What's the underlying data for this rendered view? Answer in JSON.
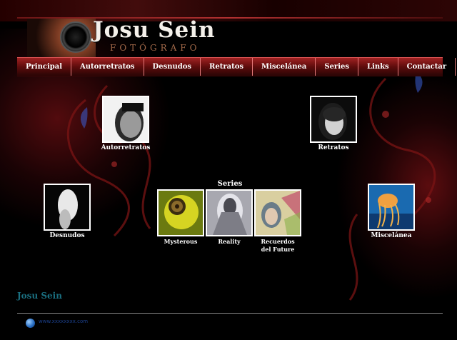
{
  "header": {
    "title": "Josu Sein",
    "subtitle": "FOTÓGRAFO"
  },
  "nav": {
    "items": [
      {
        "label": "Principal"
      },
      {
        "label": "Autorretratos"
      },
      {
        "label": "Desnudos"
      },
      {
        "label": "Retratos"
      },
      {
        "label": "Miscelánea"
      },
      {
        "label": "Series"
      },
      {
        "label": "Links"
      },
      {
        "label": "Contactar"
      }
    ]
  },
  "gallery": {
    "autorretratos": {
      "caption": "Autorretratos"
    },
    "retratos": {
      "caption": "Retratos"
    },
    "desnudos": {
      "caption": "Desnudos"
    },
    "miscelanea": {
      "caption": "Miscelánea"
    },
    "series_title": "Series",
    "series": [
      {
        "caption": "Mysterous"
      },
      {
        "caption": "Reality"
      },
      {
        "caption_line1": "Recuerdos",
        "caption_line2": "del Future"
      }
    ]
  },
  "footer": {
    "name": "Josu Sein",
    "link": "www.xxxxxxxx.com"
  },
  "colors": {
    "nav_bg": "#8e1a1a",
    "footer_name": "#1a6f80",
    "background": "#000000"
  }
}
